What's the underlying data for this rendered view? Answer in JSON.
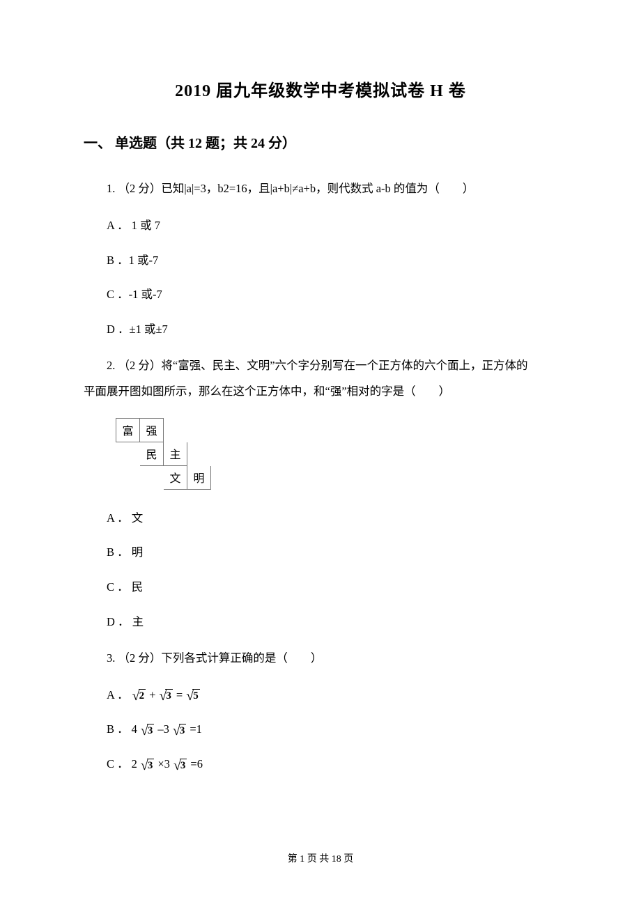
{
  "title": "2019 届九年级数学中考模拟试卷 H 卷",
  "section": "一、 单选题（共 12 题；共 24 分）",
  "q1": {
    "stem": "1. （2 分）已知|a|=3，b2=16，且|a+b|≠a+b，则代数式 a‐b 的值为（　　）",
    "A": "A ． 1 或 7",
    "B": "B ．1 或‐7",
    "C": "C ．‐1 或‐7",
    "D": "D ．±1 或±7"
  },
  "q2": {
    "stem_line1": "2. （2 分）将“富强、民主、文明”六个字分别写在一个正方体的六个面上，正方体的",
    "stem_line2": "平面展开图如图所示，那么在这个正方体中，和“强”相对的字是（　　）",
    "net": {
      "r1c1": "富",
      "r1c2": "强",
      "r2c2": "民",
      "r2c3": "主",
      "r3c3": "文",
      "r3c4": "明"
    },
    "A": "A ． 文",
    "B": "B ． 明",
    "C": "C ． 民",
    "D": "D ． 主"
  },
  "q3": {
    "stem": "3. （2 分）下列各式计算正确的是（　　）",
    "A": {
      "label": "A ．",
      "a": "2",
      "plus": "+",
      "b": "3",
      "eq": "=",
      "c": "5"
    },
    "B": {
      "label": "B ．",
      "coef1": "4",
      "a": "3",
      "minus": "–3",
      "b": "3",
      "eq": "=1"
    },
    "C": {
      "label": "C ．",
      "coef1": "2",
      "a": "3",
      "times": "×3",
      "b": "3",
      "eq": "=6"
    }
  },
  "footer": "第 1 页 共 18 页"
}
